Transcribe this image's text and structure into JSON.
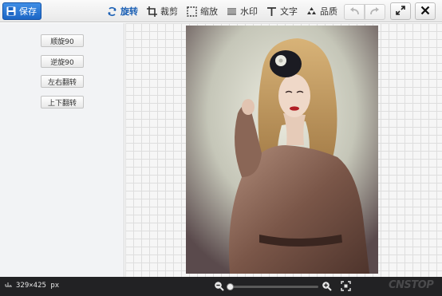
{
  "toolbar": {
    "save_label": "保存",
    "tools": [
      {
        "id": "rotate",
        "label": "旋转",
        "icon": "rotate-icon",
        "active": true
      },
      {
        "id": "crop",
        "label": "裁剪",
        "icon": "crop-icon",
        "active": false
      },
      {
        "id": "resize",
        "label": "缩放",
        "icon": "resize-icon",
        "active": false
      },
      {
        "id": "watermark",
        "label": "水印",
        "icon": "watermark-icon",
        "active": false
      },
      {
        "id": "text",
        "label": "文字",
        "icon": "text-icon",
        "active": false
      },
      {
        "id": "quality",
        "label": "品质",
        "icon": "quality-icon",
        "active": false
      }
    ],
    "undo_icon": "undo-icon",
    "redo_icon": "redo-icon",
    "fullscreen_icon": "fullscreen-icon",
    "close_icon": "close-icon"
  },
  "sidebar": {
    "buttons": [
      {
        "id": "rotate-cw",
        "label": "顺旋90"
      },
      {
        "id": "rotate-ccw",
        "label": "逆旋90"
      },
      {
        "id": "flip-horizontal",
        "label": "左右翻转"
      },
      {
        "id": "flip-vertical",
        "label": "上下翻转"
      }
    ]
  },
  "statusbar": {
    "image_size": "329×425 px",
    "zoom_level": 0.03,
    "brand": "CNSTOP"
  },
  "colors": {
    "accent": "#1c66c5",
    "active_tool": "#1a5fb4",
    "statusbar_bg": "#222224",
    "sidebar_bg": "#f2f3f5"
  }
}
